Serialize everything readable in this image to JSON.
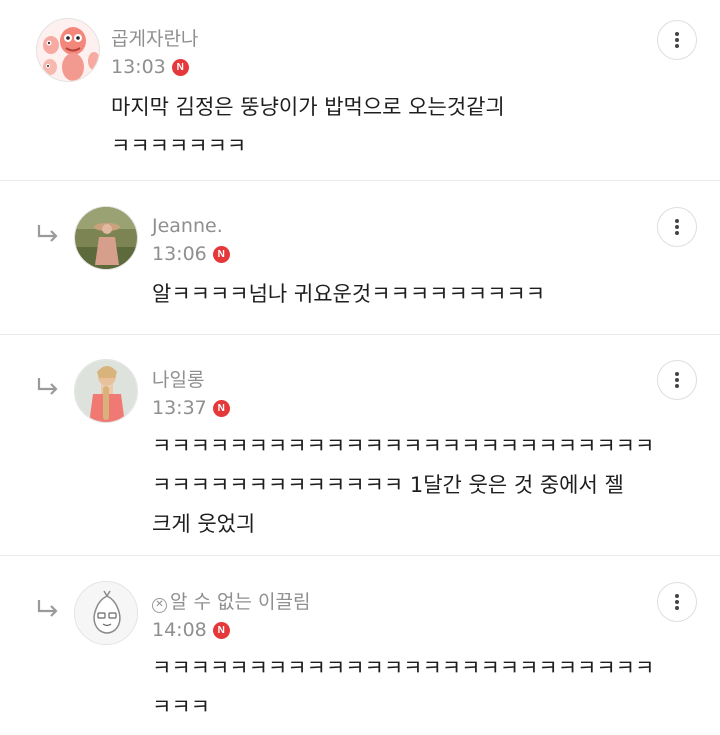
{
  "comments": [
    {
      "author": "곱게자란나",
      "time": "13:03",
      "badge": "N",
      "lines": [
        "마지막 김정은 뚱냥이가 밥먹으로 오는것같긔",
        "ㅋㅋㅋㅋㅋㅋㅋ"
      ],
      "is_reply": false
    },
    {
      "author": "Jeanne.",
      "time": "13:06",
      "badge": "N",
      "lines": [
        "알ㅋㅋㅋㅋ넘나 귀요운것ㅋㅋㅋㅋㅋㅋㅋㅋㅋ"
      ],
      "is_reply": true
    },
    {
      "author": "나일롱",
      "time": "13:37",
      "badge": "N",
      "lines": [
        "ㅋㅋㅋㅋㅋㅋㅋㅋㅋㅋㅋㅋㅋㅋㅋㅋㅋㅋㅋㅋㅋㅋㅋㅋㅋㅋ",
        "ㅋㅋㅋㅋㅋㅋㅋㅋㅋㅋㅋㅋㅋ 1달간 웃은 것 중에서 젤",
        "크게 웃었긔"
      ],
      "is_reply": true
    },
    {
      "author": "알 수 없는 이끌림",
      "time": "14:08",
      "badge": "N",
      "lines": [
        "ㅋㅋㅋㅋㅋㅋㅋㅋㅋㅋㅋㅋㅋㅋㅋㅋㅋㅋㅋㅋㅋㅋㅋㅋㅋㅋ",
        "ㅋㅋㅋ"
      ],
      "is_reply": true,
      "author_prefix_icon": "x-circle-icon"
    }
  ],
  "icons": {
    "more": "more-vertical-icon",
    "reply": "reply-arrow-icon",
    "badge": "new-badge"
  },
  "colors": {
    "badge": "#e5383b",
    "meta_text": "#8f8f8f",
    "body_text": "#1e1e1e",
    "divider": "#ebebeb"
  }
}
